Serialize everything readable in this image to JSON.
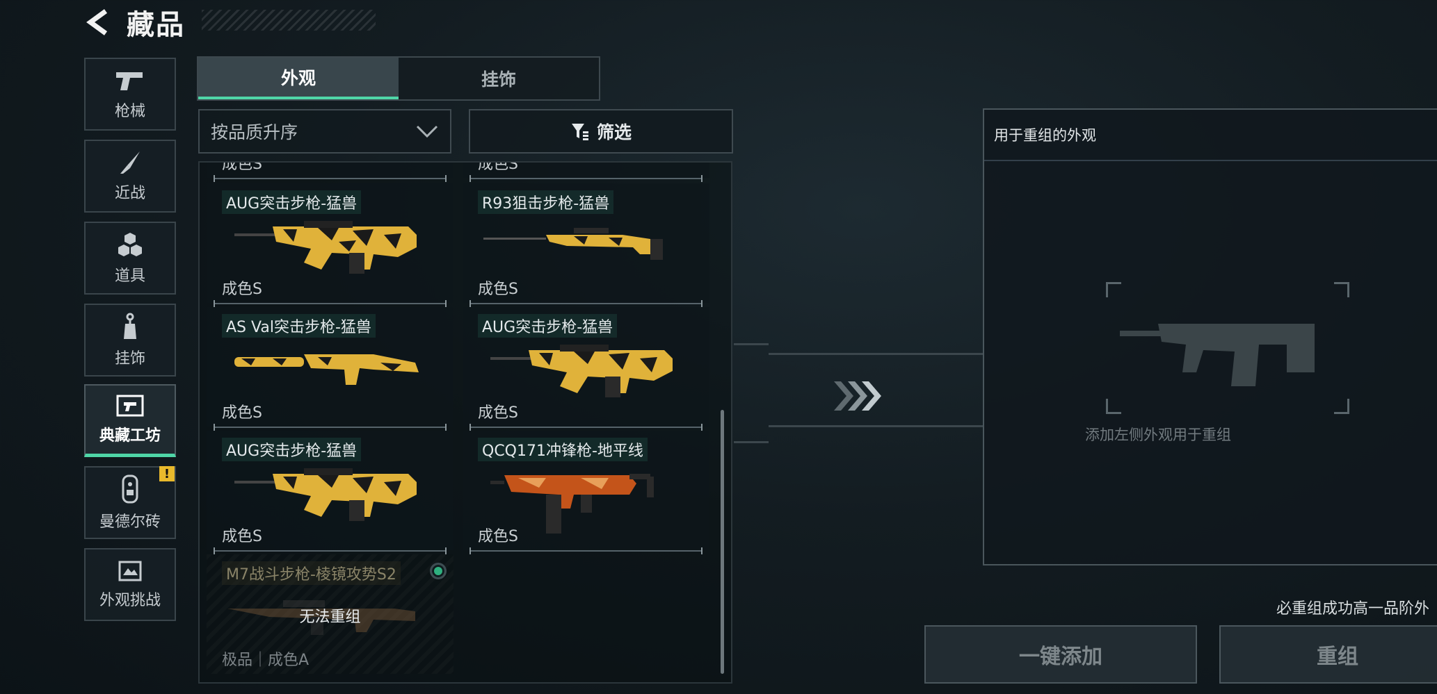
{
  "header": {
    "title": "藏品"
  },
  "sidebar": {
    "items": [
      {
        "label": "枪械",
        "icon": "pistol-icon"
      },
      {
        "label": "近战",
        "icon": "knife-icon"
      },
      {
        "label": "道具",
        "icon": "hexagons-icon"
      },
      {
        "label": "挂饰",
        "icon": "charm-icon"
      },
      {
        "label": "典藏工坊",
        "icon": "workshop-icon",
        "active": true
      },
      {
        "label": "曼德尔砖",
        "icon": "brick-icon",
        "badge": "!"
      },
      {
        "label": "外观挑战",
        "icon": "challenge-icon"
      }
    ]
  },
  "tabs": [
    {
      "label": "外观",
      "active": true
    },
    {
      "label": "挂饰"
    }
  ],
  "sort": {
    "value": "按品质升序"
  },
  "filter": {
    "label": "筛选"
  },
  "list": {
    "partial_top": [
      "成色S",
      "成色S"
    ],
    "items": [
      {
        "name": "AUG突击步枪-猛兽",
        "condition": "成色S",
        "skin": "tiger"
      },
      {
        "name": "R93狙击步枪-猛兽",
        "condition": "成色S",
        "skin": "tiger"
      },
      {
        "name": "AS Val突击步枪-猛兽",
        "condition": "成色S",
        "skin": "tiger"
      },
      {
        "name": "AUG突击步枪-猛兽",
        "condition": "成色S",
        "skin": "tiger"
      },
      {
        "name": "AUG突击步枪-猛兽",
        "condition": "成色S",
        "skin": "tiger"
      },
      {
        "name": "QCQ171冲锋枪-地平线",
        "condition": "成色S",
        "skin": "horizon"
      },
      {
        "name": "M7战斗步枪-棱镜攻势S2",
        "condition": "极品｜成色A",
        "overlay": "无法重组",
        "disabled": true
      }
    ]
  },
  "recombine": {
    "panel_title": "用于重组的外观",
    "hint": "添加左侧外观用于重组",
    "promise": "必重组成功高一品阶外",
    "add_all": "一键添加",
    "recombine": "重组"
  },
  "colors": {
    "accent": "#4fd6a7",
    "tiger_gold": "#e0b23a",
    "warn": "#e8b92c"
  }
}
